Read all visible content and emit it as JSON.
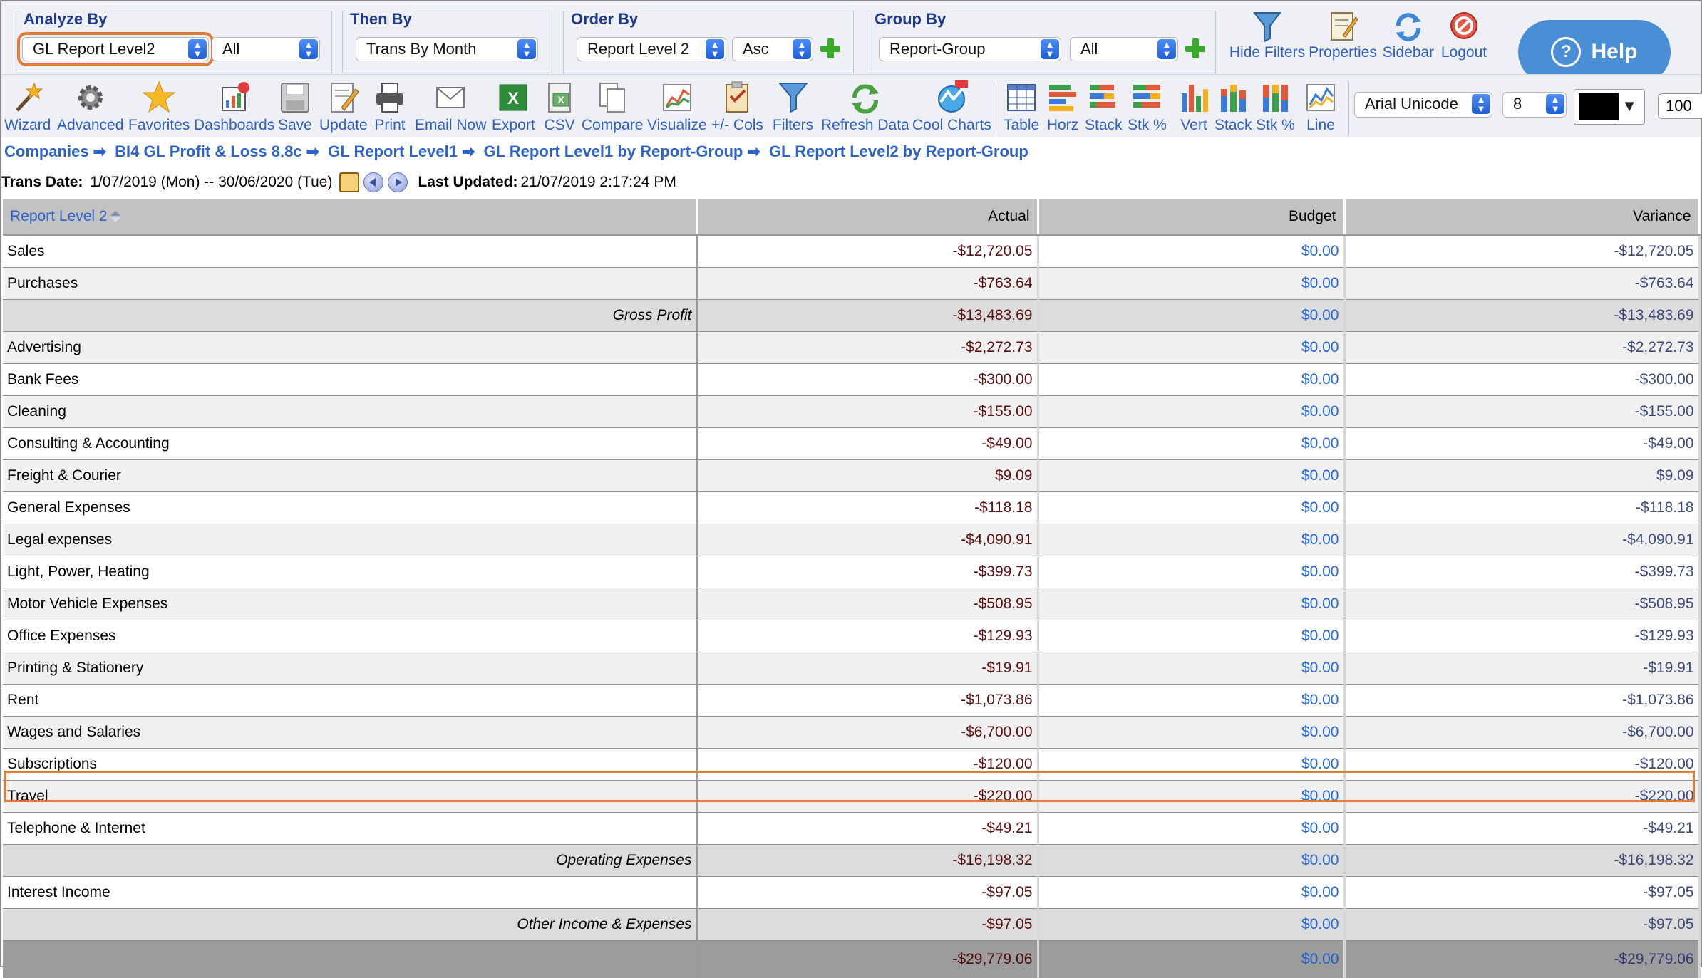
{
  "controls": {
    "analyze_by": {
      "title": "Analyze By",
      "value": "GL Report Level2",
      "filter": "All"
    },
    "then_by": {
      "title": "Then By",
      "value": "Trans By Month"
    },
    "order_by": {
      "title": "Order By",
      "value": "Report Level 2",
      "direction": "Asc"
    },
    "group_by": {
      "title": "Group By",
      "value": "Report-Group",
      "filter": "All"
    }
  },
  "top_actions": [
    "Hide Filters",
    "Properties",
    "Sidebar",
    "Logout"
  ],
  "help_label": "Help",
  "toolbar": {
    "buttons": [
      "Wizard",
      "Advanced",
      "Favorites",
      "Dashboards",
      "Save",
      "Update",
      "Print",
      "Email Now",
      "Export",
      "CSV",
      "Compare",
      "Visualize",
      "+/- Cols",
      "Filters",
      "Refresh Data",
      "Cool Charts"
    ],
    "chart_buttons": [
      "Table",
      "Horz",
      "Stack",
      "Stk %",
      "Vert",
      "Stack",
      "Stk %",
      "Line"
    ],
    "font": "Arial Unicode",
    "font_size": "8",
    "zoom": "100"
  },
  "breadcrumb": [
    "Companies",
    "BI4 GL Profit & Loss 8.8c",
    "GL Report Level1",
    "GL Report Level1 by Report-Group",
    "GL Report Level2 by Report-Group"
  ],
  "dates": {
    "trans_label": "Trans Date:",
    "trans_value": "1/07/2019 (Mon) -- 30/06/2020 (Tue)",
    "updated_label": "Last Updated:",
    "updated_value": "21/07/2019 2:17:24 PM"
  },
  "table": {
    "headers": [
      "Report Level 2",
      "Actual",
      "Budget",
      "Variance"
    ],
    "rows": [
      {
        "name": "Sales",
        "actual": "-$12,720.05",
        "budget": "$0.00",
        "variance": "-$12,720.05",
        "kind": "row"
      },
      {
        "name": "Purchases",
        "actual": "-$763.64",
        "budget": "$0.00",
        "variance": "-$763.64",
        "kind": "row"
      },
      {
        "name": "Gross Profit",
        "actual": "-$13,483.69",
        "budget": "$0.00",
        "variance": "-$13,483.69",
        "kind": "sub"
      },
      {
        "name": "Advertising",
        "actual": "-$2,272.73",
        "budget": "$0.00",
        "variance": "-$2,272.73",
        "kind": "row"
      },
      {
        "name": "Bank Fees",
        "actual": "-$300.00",
        "budget": "$0.00",
        "variance": "-$300.00",
        "kind": "row"
      },
      {
        "name": "Cleaning",
        "actual": "-$155.00",
        "budget": "$0.00",
        "variance": "-$155.00",
        "kind": "row"
      },
      {
        "name": "Consulting & Accounting",
        "actual": "-$49.00",
        "budget": "$0.00",
        "variance": "-$49.00",
        "kind": "row"
      },
      {
        "name": "Freight & Courier",
        "actual": "$9.09",
        "budget": "$0.00",
        "variance": "$9.09",
        "kind": "row"
      },
      {
        "name": "General Expenses",
        "actual": "-$118.18",
        "budget": "$0.00",
        "variance": "-$118.18",
        "kind": "row"
      },
      {
        "name": "Legal expenses",
        "actual": "-$4,090.91",
        "budget": "$0.00",
        "variance": "-$4,090.91",
        "kind": "row"
      },
      {
        "name": "Light, Power, Heating",
        "actual": "-$399.73",
        "budget": "$0.00",
        "variance": "-$399.73",
        "kind": "row"
      },
      {
        "name": "Motor Vehicle Expenses",
        "actual": "-$508.95",
        "budget": "$0.00",
        "variance": "-$508.95",
        "kind": "row"
      },
      {
        "name": "Office Expenses",
        "actual": "-$129.93",
        "budget": "$0.00",
        "variance": "-$129.93",
        "kind": "row"
      },
      {
        "name": "Printing & Stationery",
        "actual": "-$19.91",
        "budget": "$0.00",
        "variance": "-$19.91",
        "kind": "row"
      },
      {
        "name": "Rent",
        "actual": "-$1,073.86",
        "budget": "$0.00",
        "variance": "-$1,073.86",
        "kind": "row"
      },
      {
        "name": "Wages and Salaries",
        "actual": "-$6,700.00",
        "budget": "$0.00",
        "variance": "-$6,700.00",
        "kind": "row"
      },
      {
        "name": "Subscriptions",
        "actual": "-$120.00",
        "budget": "$0.00",
        "variance": "-$120.00",
        "kind": "row"
      },
      {
        "name": "Travel",
        "actual": "-$220.00",
        "budget": "$0.00",
        "variance": "-$220.00",
        "kind": "row"
      },
      {
        "name": "Telephone & Internet",
        "actual": "-$49.21",
        "budget": "$0.00",
        "variance": "-$49.21",
        "kind": "row"
      },
      {
        "name": "Operating Expenses",
        "actual": "-$16,198.32",
        "budget": "$0.00",
        "variance": "-$16,198.32",
        "kind": "sub"
      },
      {
        "name": "Interest Income",
        "actual": "-$97.05",
        "budget": "$0.00",
        "variance": "-$97.05",
        "kind": "row"
      },
      {
        "name": "Other Income & Expenses",
        "actual": "-$97.05",
        "budget": "$0.00",
        "variance": "-$97.05",
        "kind": "sub"
      },
      {
        "name": "",
        "actual": "-$29,779.06",
        "budget": "$0.00",
        "variance": "-$29,779.06",
        "kind": "total"
      }
    ]
  },
  "colors": {
    "highlight": "#e07b3a",
    "link": "#2e63c8",
    "accent": "#1f3a8a"
  }
}
